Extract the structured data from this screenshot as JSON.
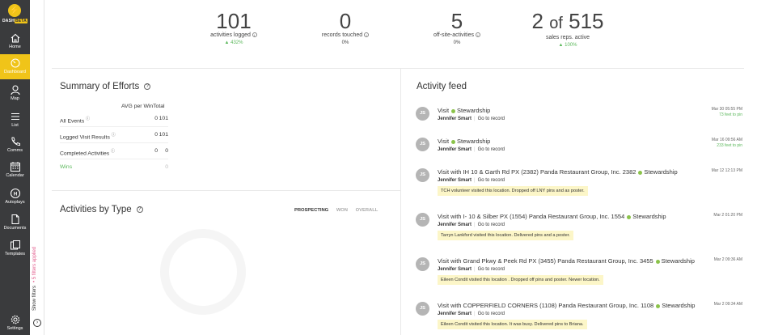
{
  "brand": {
    "name": "DASH",
    "beta": "BETA"
  },
  "sidebar": {
    "items": [
      {
        "label": "Home",
        "icon": "home-icon",
        "active": false
      },
      {
        "label": "Dashboard",
        "icon": "dashboard-icon",
        "active": true
      },
      {
        "label": "Map",
        "icon": "map-icon",
        "active": false
      },
      {
        "label": "List",
        "icon": "list-icon",
        "active": false
      },
      {
        "label": "Comms",
        "icon": "phone-icon",
        "active": false
      },
      {
        "label": "Calendar",
        "icon": "calendar-icon",
        "active": false
      },
      {
        "label": "Autoplays",
        "icon": "autoplay-icon",
        "active": false
      },
      {
        "label": "Documents",
        "icon": "document-icon",
        "active": false
      },
      {
        "label": "Templates",
        "icon": "templates-icon",
        "active": false
      }
    ],
    "settings": "Settings"
  },
  "filters": {
    "show": "Show filters",
    "applied": "• 5 filters applied"
  },
  "stats": [
    {
      "value": "101",
      "label": "activities logged",
      "change": "▲ 432%",
      "trend": "up"
    },
    {
      "value": "0",
      "label": "records touched",
      "change": "0%",
      "trend": "flat"
    },
    {
      "value": "5",
      "label": "off-site-activities",
      "change": "0%",
      "trend": "flat"
    },
    {
      "value": "2",
      "of": "of",
      "total": "515",
      "label": "sales reps. active",
      "change": "▲ 100%",
      "trend": "up"
    }
  ],
  "summary": {
    "title": "Summary of Efforts",
    "header": "AVG per WinTotal",
    "rows": [
      {
        "label": "All Events",
        "avg": "0",
        "total": "101",
        "info": true
      },
      {
        "label": "Logged Visit Results",
        "avg": "0",
        "total": "101",
        "info": true
      },
      {
        "label": "Completed Activities",
        "avg": "0",
        "total": "0",
        "info": true
      },
      {
        "label": "Wins",
        "avg": "",
        "total": "0",
        "info": false
      }
    ]
  },
  "activities_by_type": {
    "title": "Activities by Type",
    "tabs": [
      "PROSPECTING",
      "WON",
      "OVERALL"
    ],
    "active_tab": "PROSPECTING"
  },
  "feed": {
    "title": "Activity feed",
    "items": [
      {
        "initials": "JS",
        "title": "Visit",
        "tag": "Stewardship",
        "user": "Jennifer Smart",
        "link": "Go to record",
        "time": "Mar 30 05:55 PM",
        "distance": "73 feet to pin",
        "note": ""
      },
      {
        "initials": "JS",
        "title": "Visit",
        "tag": "Stewardship",
        "user": "Jennifer Smart",
        "link": "Go to record",
        "time": "Mar 16 09:56 AM",
        "distance": "233 feet to pin",
        "note": ""
      },
      {
        "initials": "JS",
        "title": "Visit with IH 10 & Garth Rd PX (2382) Panda Restaurant Group, Inc. 2382",
        "tag": "Stewardship",
        "user": "Jennifer Smart",
        "link": "Go to record",
        "time": "Mar 12 12:13 PM",
        "distance": "",
        "note": "TCH volunteer visited this location. Dropped off LNY pins and as poster."
      },
      {
        "initials": "JS",
        "title": "Visit with I- 10 & Silber PX (1554) Panda Restaurant Group, Inc. 1554",
        "tag": "Stewardship",
        "user": "Jennifer Smart",
        "link": "Go to record",
        "time": "Mar 2 01:20 PM",
        "distance": "",
        "note": "Tarryn Lankford visited this location. Delivered pins and a poster."
      },
      {
        "initials": "JS",
        "title": "Visit with Grand Pkwy & Peek Rd PX (3455) Panda Restaurant Group, Inc. 3455",
        "tag": "Stewardship",
        "user": "Jennifer Smart",
        "link": "Go to record",
        "time": "Mar 2 09:36 AM",
        "distance": "",
        "note": "Eileen Condit visited this location . Dropped off pins and poster. Newer location."
      },
      {
        "initials": "JS",
        "title": "Visit with COPPERFIELD CORNERS (1108) Panda Restaurant Group, Inc. 1108",
        "tag": "Stewardship",
        "user": "Jennifer Smart",
        "link": "Go to record",
        "time": "Mar 2 09:34 AM",
        "distance": "",
        "note": "Eileen Condit visited this location. It was busy. Delivered pins to Briana."
      }
    ]
  }
}
